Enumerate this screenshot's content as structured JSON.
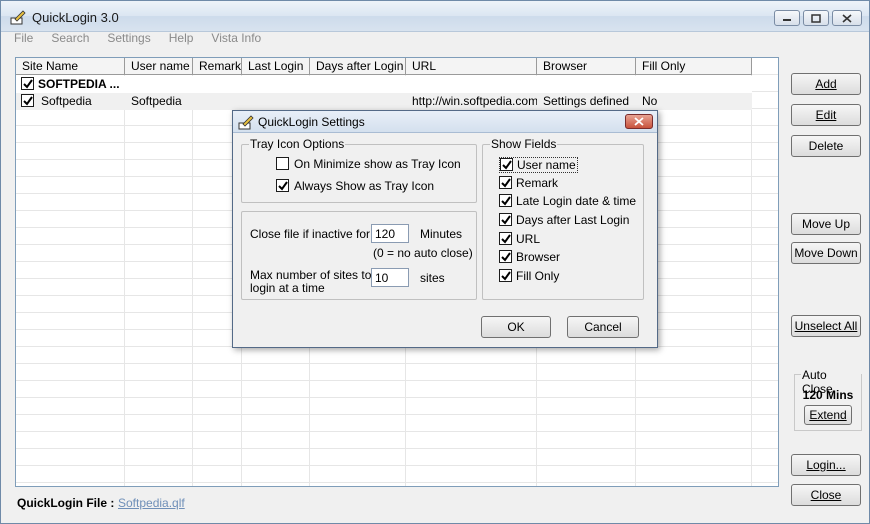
{
  "window": {
    "title": "QuickLogin 3.0",
    "menu": [
      "File",
      "Search",
      "Settings",
      "Help",
      "Vista Info"
    ]
  },
  "grid": {
    "columns": [
      "Site Name",
      "User name",
      "Remark",
      "Last Login",
      "Days after Login",
      "URL",
      "Browser",
      "Fill Only"
    ],
    "group_row": {
      "label": "SOFTPEDIA ...",
      "checked": true
    },
    "rows": [
      {
        "site": "Softpedia",
        "user": "Softpedia",
        "remark": "",
        "last_login": "",
        "days": "",
        "url": "http://win.softpedia.com",
        "browser": "Settings defined",
        "fill_only": "No",
        "checked": true
      }
    ]
  },
  "footer": {
    "file_label": "QuickLogin File :",
    "file_name": "Softpedia.qlf"
  },
  "buttons": {
    "add": "Add",
    "edit": "Edit",
    "delete": "Delete",
    "move_up": "Move Up",
    "move_down": "Move Down",
    "unselect_all": "Unselect All",
    "login": "Login...",
    "close": "Close"
  },
  "auto_close": {
    "label": "Auto Close",
    "value": "120 Mins",
    "extend": "Extend"
  },
  "dialog": {
    "title": "QuickLogin Settings",
    "tray_group": "Tray Icon Options",
    "tray_options": [
      {
        "label": "On Minimize show as Tray Icon",
        "checked": false
      },
      {
        "label": "Always Show as Tray Icon",
        "checked": true
      }
    ],
    "close_file_label": "Close file if inactive for",
    "close_file_value": "120",
    "minutes": "Minutes",
    "no_auto_close": "(0 = no auto close)",
    "max_sites_label_1": "Max number of sites to",
    "max_sites_label_2": "login at a time",
    "max_sites_value": "10",
    "sites": "sites",
    "show_fields_group": "Show Fields",
    "fields": [
      {
        "label": "User name",
        "checked": true
      },
      {
        "label": "Remark",
        "checked": true
      },
      {
        "label": "Late Login date & time",
        "checked": true
      },
      {
        "label": "Days after Last Login",
        "checked": true
      },
      {
        "label": "URL",
        "checked": true
      },
      {
        "label": "Browser",
        "checked": true
      },
      {
        "label": "Fill Only",
        "checked": true
      }
    ],
    "ok": "OK",
    "cancel": "Cancel"
  }
}
